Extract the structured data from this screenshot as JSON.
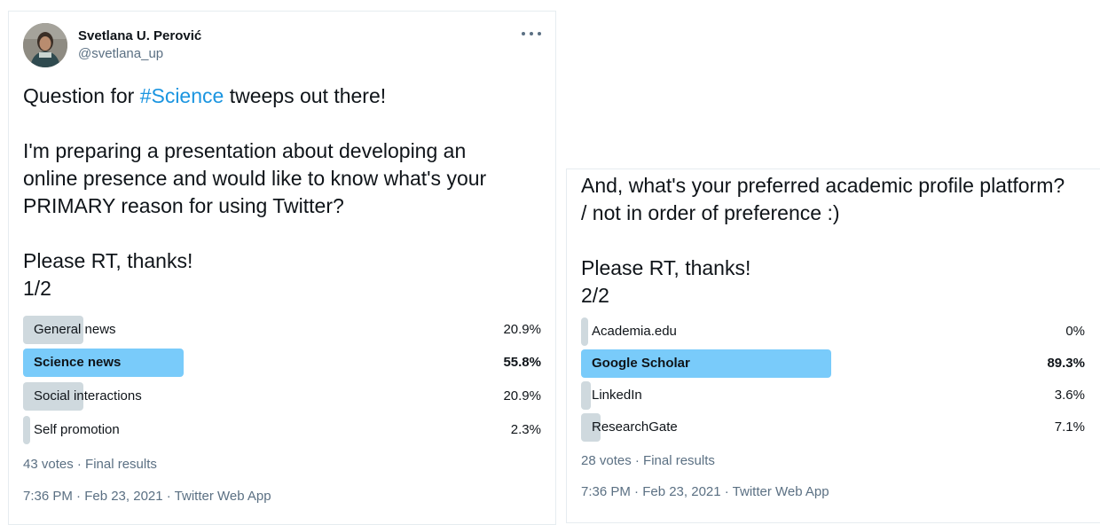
{
  "colors": {
    "text_primary": "#0f1419",
    "text_secondary": "#5b7083",
    "link": "#1b95e0",
    "poll_bar": "#cfd9de",
    "poll_bar_winner": "#79cbfa"
  },
  "tweet1": {
    "author": {
      "name": "Svetlana U. Perović",
      "handle": "@svetlana_up",
      "avatar_icon": "avatar"
    },
    "more_icon": "more-horizontal-icon",
    "text": {
      "line1_before": "Question for ",
      "line1_hashtag": "#Science",
      "line1_after": " tweeps out there!",
      "line2": "I'm preparing a presentation about developing an",
      "line3": "online presence and would like to know what's your",
      "line4": "PRIMARY reason for using Twitter?",
      "line5": "Please RT, thanks!",
      "line6": "1/2"
    },
    "poll": {
      "options": [
        {
          "label": "General news",
          "percent": "20.9%",
          "value": 20.9
        },
        {
          "label": "Science news",
          "percent": "55.8%",
          "value": 55.8
        },
        {
          "label": "Social interactions",
          "percent": "20.9%",
          "value": 20.9
        },
        {
          "label": "Self promotion",
          "percent": "2.3%",
          "value": 2.3
        }
      ],
      "votes": "43 votes · Final results"
    },
    "timestamp": "7:36 PM · Feb 23, 2021 · Twitter Web App"
  },
  "tweet2": {
    "text": {
      "line1": "And, what's your preferred academic profile platform?",
      "line2": "/ not in order of preference :)",
      "line3": "Please RT, thanks!",
      "line4": "2/2"
    },
    "poll": {
      "options": [
        {
          "label": "Academia.edu",
          "percent": "0%",
          "value": 0
        },
        {
          "label": "Google Scholar",
          "percent": "89.3%",
          "value": 89.3
        },
        {
          "label": "LinkedIn",
          "percent": "3.6%",
          "value": 3.6
        },
        {
          "label": "ResearchGate",
          "percent": "7.1%",
          "value": 7.1
        }
      ],
      "votes": "28 votes · Final results"
    },
    "timestamp": "7:36 PM · Feb 23, 2021 · Twitter Web App"
  }
}
